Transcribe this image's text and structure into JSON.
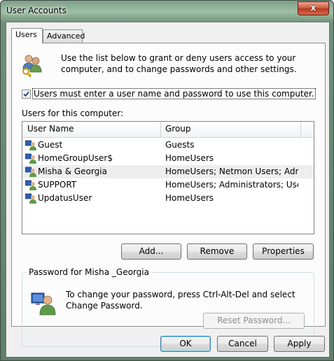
{
  "window": {
    "title": "User Accounts",
    "close_label": "x"
  },
  "tabs": [
    {
      "label": "Users",
      "active": true
    },
    {
      "label": "Advanced",
      "active": false
    }
  ],
  "intro": {
    "text": "Use the list below to grant or deny users access to your computer, and to change passwords and other settings.",
    "icon": "users-key-icon"
  },
  "require_login": {
    "label": "Users must enter a user name and password to use this computer.",
    "checked": true
  },
  "users_label": "Users for this computer:",
  "users_table": {
    "columns": [
      "User Name",
      "Group"
    ],
    "rows": [
      {
        "name": "Guest",
        "group": "Guests",
        "selected": false
      },
      {
        "name": "HomeGroupUser$",
        "group": "HomeUsers",
        "selected": false
      },
      {
        "name": "Misha & Georgia",
        "group": "HomeUsers; Netmon Users; Admi...",
        "selected": true
      },
      {
        "name": "SUPPORT",
        "group": "HomeUsers; Administrators; Users",
        "selected": false
      },
      {
        "name": "UpdatusUser",
        "group": "HomeUsers",
        "selected": false
      }
    ]
  },
  "user_buttons": {
    "add": "Add...",
    "remove": "Remove",
    "properties": "Properties"
  },
  "password_group": {
    "title": "Password for Misha _Georgia",
    "text": "To change your password, press Ctrl-Alt-Del and select Change Password.",
    "reset_button": "Reset Password...",
    "reset_enabled": false,
    "icon": "user-monitor-icon"
  },
  "dialog_buttons": {
    "ok": "OK",
    "cancel": "Cancel",
    "apply": "Apply"
  }
}
